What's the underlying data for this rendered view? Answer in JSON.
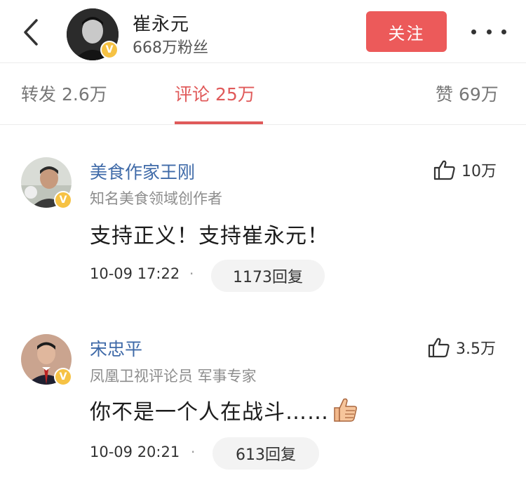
{
  "header": {
    "name": "崔永元",
    "fans": "668万粉丝",
    "follow_label": "关注",
    "verified_mark": "V"
  },
  "tabs": [
    {
      "label": "转发",
      "count": "2.6万"
    },
    {
      "label": "评论",
      "count": "25万",
      "active": true
    },
    {
      "label": "赞",
      "count": "69万"
    }
  ],
  "comments": [
    {
      "name": "美食作家王刚",
      "title": "知名美食领域创作者",
      "text": "支持正义！支持崔永元！",
      "time": "10-09 17:22",
      "separator": "·",
      "replies": "1173回复",
      "likes": "10万",
      "verified_mark": "V"
    },
    {
      "name": "宋忠平",
      "title": "凤凰卫视评论员 军事专家",
      "text": "你不是一个人在战斗……",
      "time": "10-09 20:21",
      "separator": "·",
      "replies": "613回复",
      "likes": "3.5万",
      "verified_mark": "V"
    }
  ],
  "icons": {
    "back": "chevron-left-icon",
    "more": "more-dots-icon",
    "like": "thumbs-up-icon",
    "verified": "verified-badge-icon",
    "emoji": "thumbs-up-emoji"
  },
  "colors": {
    "accent": "#e05a5a",
    "follow_button": "#ec5a5a",
    "name_link": "#3f6aa8",
    "verified": "#f6c244"
  }
}
